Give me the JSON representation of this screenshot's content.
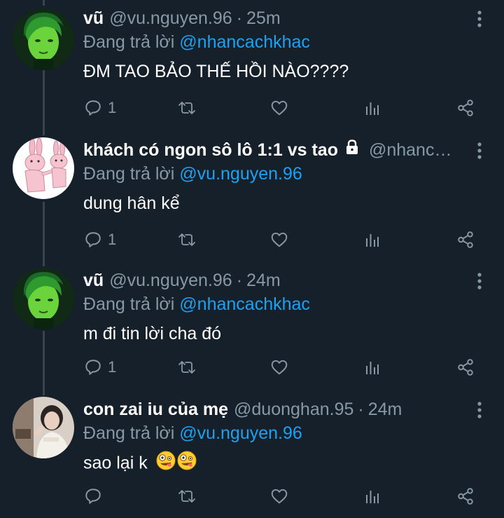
{
  "colors": {
    "background": "#15202b",
    "secondary_text": "#8899a6",
    "link": "#1da1f2",
    "thread_line": "#38444d"
  },
  "reply_prefix": "Đang trả lời",
  "tweets": [
    {
      "display_name": "vũ",
      "handle": "@vu.nguyen.96",
      "separator": "·",
      "time": "25m",
      "reply_to": "@nhancachkhac",
      "text": "ĐM TAO BẢO THẾ HỒI NÀO????",
      "reply_count": "1",
      "avatar": "green-haired-person"
    },
    {
      "display_name": "khách có ngon sô lô 1:1 vs tao",
      "locked": true,
      "handle": "@nhanc…",
      "reply_to": "@vu.nguyen.96",
      "text": "dung hân kể",
      "reply_count": "1",
      "avatar": "pink-rabbits-cartoon"
    },
    {
      "display_name": "vũ",
      "handle": "@vu.nguyen.96",
      "separator": "·",
      "time": "24m",
      "reply_to": "@nhancachkhac",
      "text": "m đi tin lời cha đó",
      "reply_count": "1",
      "avatar": "green-haired-person"
    },
    {
      "display_name": "con zai iu của mẹ",
      "handle": "@duonghan.95",
      "separator": "·",
      "time": "24m",
      "reply_to": "@vu.nguyen.96",
      "text": "sao lại k",
      "emojis": [
        "zany-face",
        "zany-face"
      ],
      "reply_count": "",
      "avatar": "person-photo"
    }
  ],
  "icons": {
    "reply": "reply-icon",
    "retweet": "retweet-icon",
    "like": "like-icon",
    "analytics": "analytics-icon",
    "share": "share-icon",
    "more": "more-icon",
    "lock": "lock-icon"
  }
}
